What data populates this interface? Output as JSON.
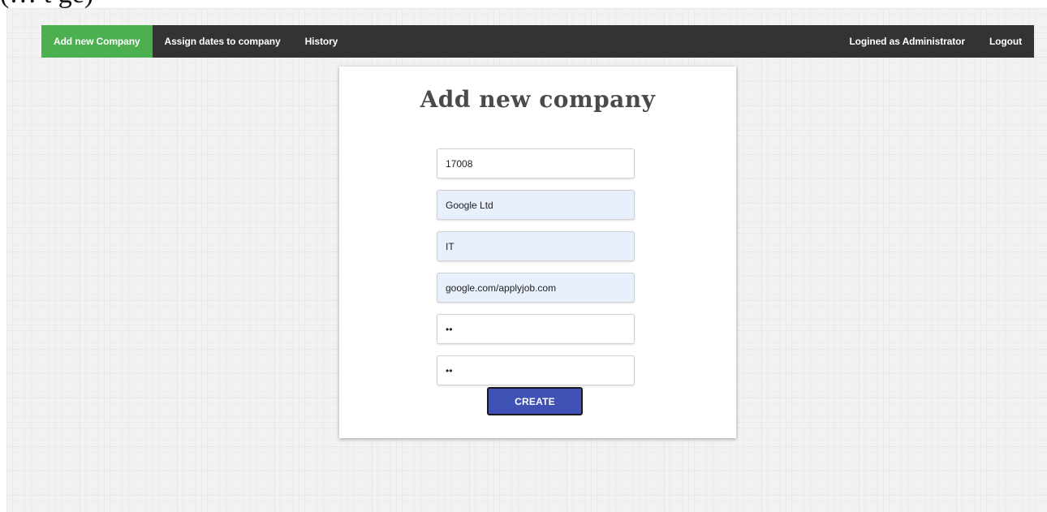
{
  "cut_off_text": "(… t   ge)",
  "nav": {
    "items": [
      {
        "label": "Add new Company",
        "active": true
      },
      {
        "label": "Assign dates to company",
        "active": false
      },
      {
        "label": "History",
        "active": false
      }
    ],
    "logged_in": "Logined as Administrator",
    "logout": "Logout",
    "colors": {
      "bar": "#333333",
      "active": "#4caf50"
    }
  },
  "form": {
    "title": "Add new company",
    "fields": [
      {
        "value": "17008",
        "type": "text"
      },
      {
        "value": "Google Ltd",
        "type": "text"
      },
      {
        "value": "IT",
        "type": "text"
      },
      {
        "value": "google.com/applyjob.com",
        "type": "text"
      },
      {
        "value": "ab",
        "type": "password"
      },
      {
        "value": "ab",
        "type": "password"
      }
    ],
    "submit_label": "CREATE",
    "submit_color": "#3f51b5"
  }
}
